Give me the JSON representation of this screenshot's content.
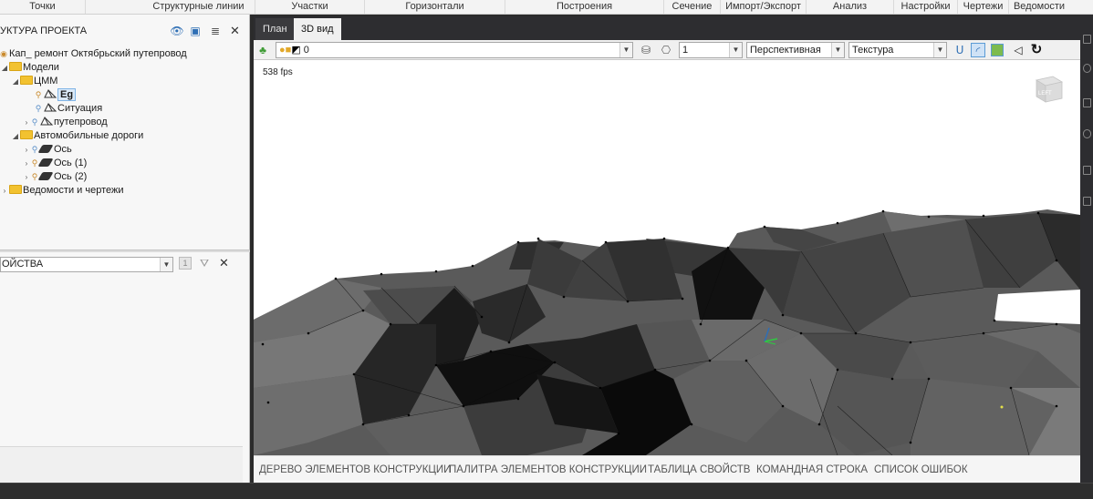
{
  "ribbon": {
    "tabs": [
      "Точки",
      "Структурные линии",
      "Участки",
      "Горизонтали",
      "Построения",
      "Сечение",
      "Импорт/Экспорт",
      "Анализ",
      "Настройки",
      "Чертежи",
      "Ведомости"
    ]
  },
  "structure_panel": {
    "title": "УКТУРА ПРОЕКТА",
    "tree": {
      "project": "Кап_ ремонт Октябрьский путепровод",
      "models": "Модели",
      "tsm": "ЦММ",
      "eg": "Eg",
      "situation": "Ситуация",
      "overpass": "путепровод",
      "roads": "Автомобильные дороги",
      "axis": "Ось",
      "axis1": "Ось (1)",
      "axis2": "Ось (2)",
      "sheets": "Ведомости и чертежи"
    }
  },
  "properties_panel": {
    "selected": "ОЙСТВА",
    "count": "1"
  },
  "view": {
    "tabs": [
      "План",
      "3D вид"
    ],
    "active_tab": "3D вид",
    "layer_value": "0",
    "scale_value": "1",
    "projection": "Перспективная",
    "render_mode": "Текстура",
    "fps": "538 fps",
    "navcube_label": "LEFT"
  },
  "bottom_tabs": [
    "ДЕРЕВО ЭЛЕМЕНТОВ КОНСТРУКЦИИ",
    "ПАЛИТРА ЭЛЕМЕНТОВ КОНСТРУКЦИИ",
    "ТАБЛИЦА СВОЙСТВ",
    "КОМАНДНАЯ СТРОКА",
    "СПИСОК ОШИБОК"
  ],
  "colors": {
    "terrain_light": "#6e6e6e",
    "terrain_mid": "#4a4a4a",
    "terrain_dark": "#1e1e1e",
    "accent": "#5b9bd5",
    "folder": "#f2c230"
  }
}
